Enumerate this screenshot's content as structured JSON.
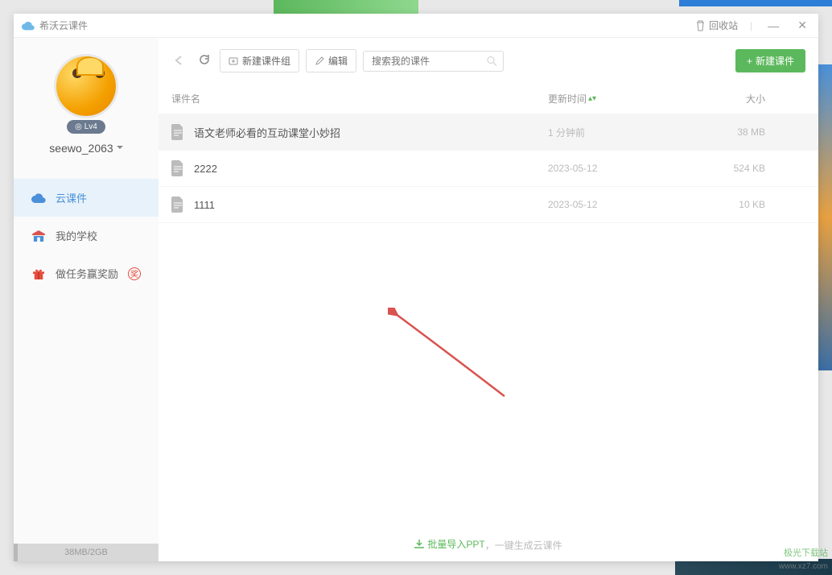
{
  "app": {
    "title": "希沃云课件"
  },
  "titlebar": {
    "recycle": "回收站"
  },
  "user": {
    "name": "seewo_2063",
    "level": "Lv4"
  },
  "sidebar": {
    "items": [
      {
        "label": "云课件"
      },
      {
        "label": "我的学校"
      },
      {
        "label": "做任务赢奖励",
        "badge": "奖"
      }
    ]
  },
  "storage": {
    "text": "38MB/2GB"
  },
  "toolbar": {
    "new_group": "新建课件组",
    "edit": "编辑",
    "search_placeholder": "搜索我的课件",
    "new_courseware": "新建课件"
  },
  "table": {
    "headers": {
      "name": "课件名",
      "time": "更新时间",
      "size": "大小"
    },
    "rows": [
      {
        "name": "语文老师必看的互动课堂小妙招",
        "time": "1 分钟前",
        "size": "38 MB"
      },
      {
        "name": "2222",
        "time": "2023-05-12",
        "size": "524 KB"
      },
      {
        "name": "1111",
        "time": "2023-05-12",
        "size": "10 KB"
      }
    ]
  },
  "footer": {
    "import": "批量导入PPT",
    "suffix": "，一键生成云课件"
  },
  "watermark": {
    "top": "极光下载站",
    "bottom": "www.xz7.com"
  }
}
